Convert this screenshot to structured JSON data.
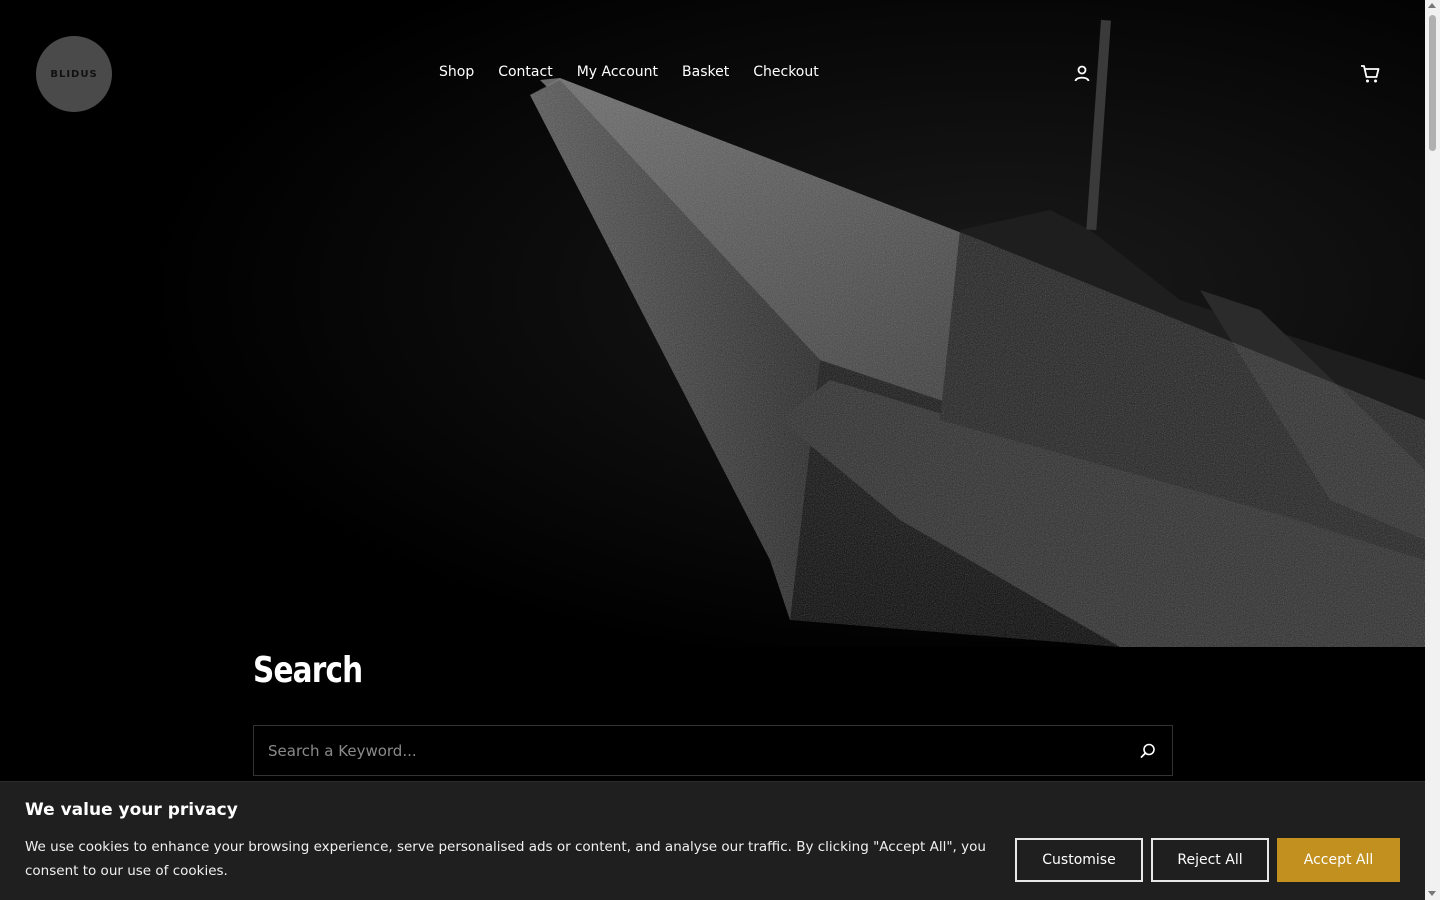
{
  "header": {
    "logo_text": "BLIDUS",
    "nav": [
      {
        "label": "Shop"
      },
      {
        "label": "Contact"
      },
      {
        "label": "My Account"
      },
      {
        "label": "Basket"
      },
      {
        "label": "Checkout"
      }
    ],
    "account_icon": "user-icon",
    "cart_icon": "cart-icon"
  },
  "hero": {
    "image_subject": "knife-blade-closeup"
  },
  "search": {
    "title": "Search",
    "placeholder": "Search a Keyword...",
    "button_icon": "search-icon"
  },
  "cookie_banner": {
    "title": "We value your privacy",
    "text": "We use cookies to enhance your browsing experience, serve personalised ads or content, and analyse our traffic. By clicking \"Accept All\", you consent to our use of cookies.",
    "customise_label": "Customise",
    "reject_label": "Reject All",
    "accept_label": "Accept All",
    "accent_color": "#c1901f"
  }
}
